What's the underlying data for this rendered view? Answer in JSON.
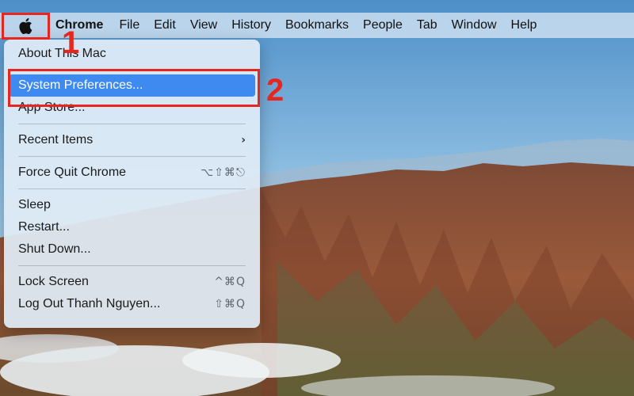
{
  "menubar": {
    "apple_icon": "apple-logo-icon",
    "items": [
      "Chrome",
      "File",
      "Edit",
      "View",
      "History",
      "Bookmarks",
      "People",
      "Tab",
      "Window",
      "Help"
    ]
  },
  "apple_menu": {
    "about": "About This Mac",
    "system_preferences": "System Preferences...",
    "app_store": "App Store...",
    "recent_items": "Recent Items",
    "recent_items_chevron": "›",
    "force_quit": "Force Quit Chrome",
    "force_quit_shortcut": "⌥⇧⌘⎋",
    "sleep": "Sleep",
    "restart": "Restart...",
    "shut_down": "Shut Down...",
    "lock_screen": "Lock Screen",
    "lock_screen_shortcut": "^⌘Q",
    "log_out": "Log Out Thanh Nguyen...",
    "log_out_shortcut": "⇧⌘Q"
  },
  "annotations": {
    "step1": "1",
    "step2": "2",
    "color": "#e6261f"
  },
  "colors": {
    "highlight": "#3f8af0",
    "sky": "#7fb3d8",
    "mountain": "#8a4b32"
  }
}
